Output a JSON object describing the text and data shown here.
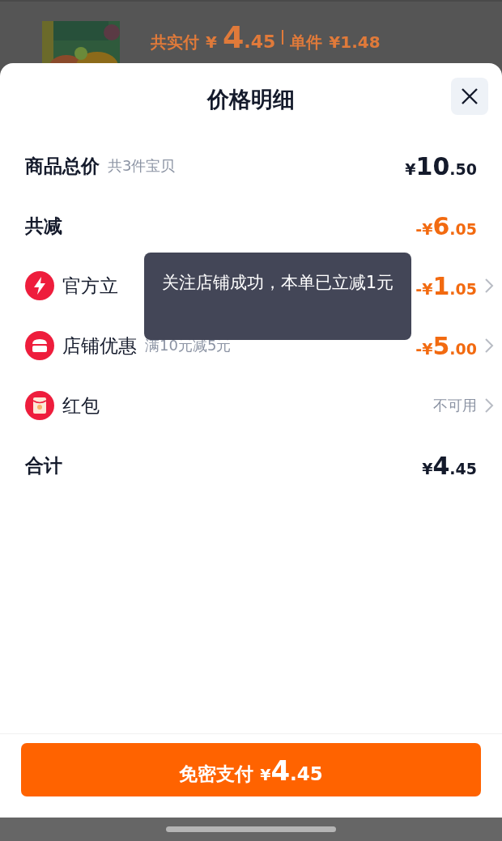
{
  "background": {
    "paid_label": "共实付",
    "paid_price": {
      "prefix": "¥",
      "major": "4",
      "minor": ".45"
    },
    "unit_label": "单件",
    "unit_price": "¥1.48"
  },
  "sheet": {
    "title": "价格明细",
    "rows": [
      {
        "kind": "subtotal",
        "label": "商品总价",
        "note": "共3件宝贝",
        "price": {
          "prefix": "¥",
          "major": "10",
          "minor": ".50"
        }
      },
      {
        "kind": "reduction",
        "label": "共减",
        "price": {
          "prefix": "-¥",
          "major": "6",
          "minor": ".05"
        }
      },
      {
        "kind": "instant",
        "label": "官方立",
        "price": {
          "prefix": "-¥",
          "major": "1",
          "minor": ".05"
        }
      },
      {
        "kind": "store",
        "label": "店铺优惠",
        "note": "满10元减5元",
        "price": {
          "prefix": "-¥",
          "major": "5",
          "minor": ".00"
        }
      },
      {
        "kind": "packet",
        "label": "红包",
        "status": "不可用"
      },
      {
        "kind": "total",
        "label": "合计",
        "price": {
          "prefix": "¥",
          "major": "4",
          "minor": ".45"
        }
      }
    ],
    "toast": "关注店铺成功，本单已立减1元",
    "pay_button": {
      "label": "免密支付",
      "price": {
        "prefix": "¥",
        "major": "4",
        "minor": ".45"
      }
    }
  }
}
